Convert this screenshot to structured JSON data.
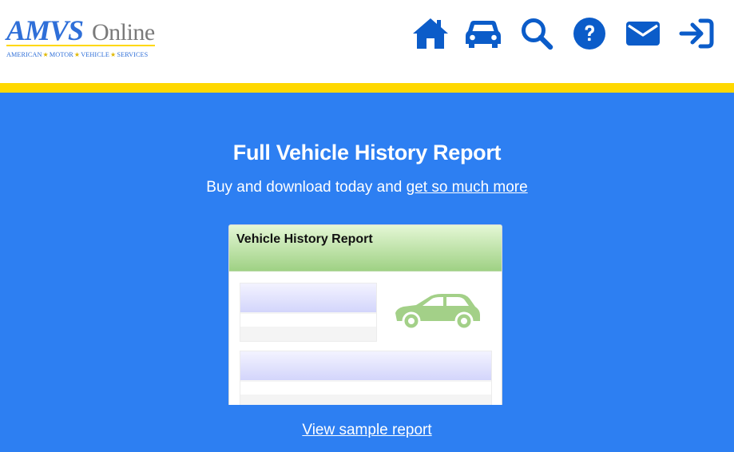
{
  "header": {
    "logo": {
      "brand": "AMVS",
      "suffix": "Online",
      "tagline_parts": [
        "AMERICAN",
        "MOTOR",
        "VEHICLE",
        "SERVICES"
      ]
    },
    "nav": [
      {
        "icon": "home-icon"
      },
      {
        "icon": "car-icon"
      },
      {
        "icon": "search-icon"
      },
      {
        "icon": "help-icon"
      },
      {
        "icon": "envelope-icon"
      },
      {
        "icon": "sign-in-icon"
      }
    ]
  },
  "hero": {
    "title": "Full Vehicle History Report",
    "subtitle": "Buy and download today and",
    "subtitle_link": "get so much more"
  },
  "report_preview": {
    "title": "Vehicle History Report"
  },
  "sample_link": "View sample report",
  "colors": {
    "brand_blue": "#0b5cc9",
    "page_background": "#2d7ff2",
    "accent_yellow": "#ffd800",
    "report_header_green": "#9fd184",
    "car_green": "#a3d088"
  }
}
